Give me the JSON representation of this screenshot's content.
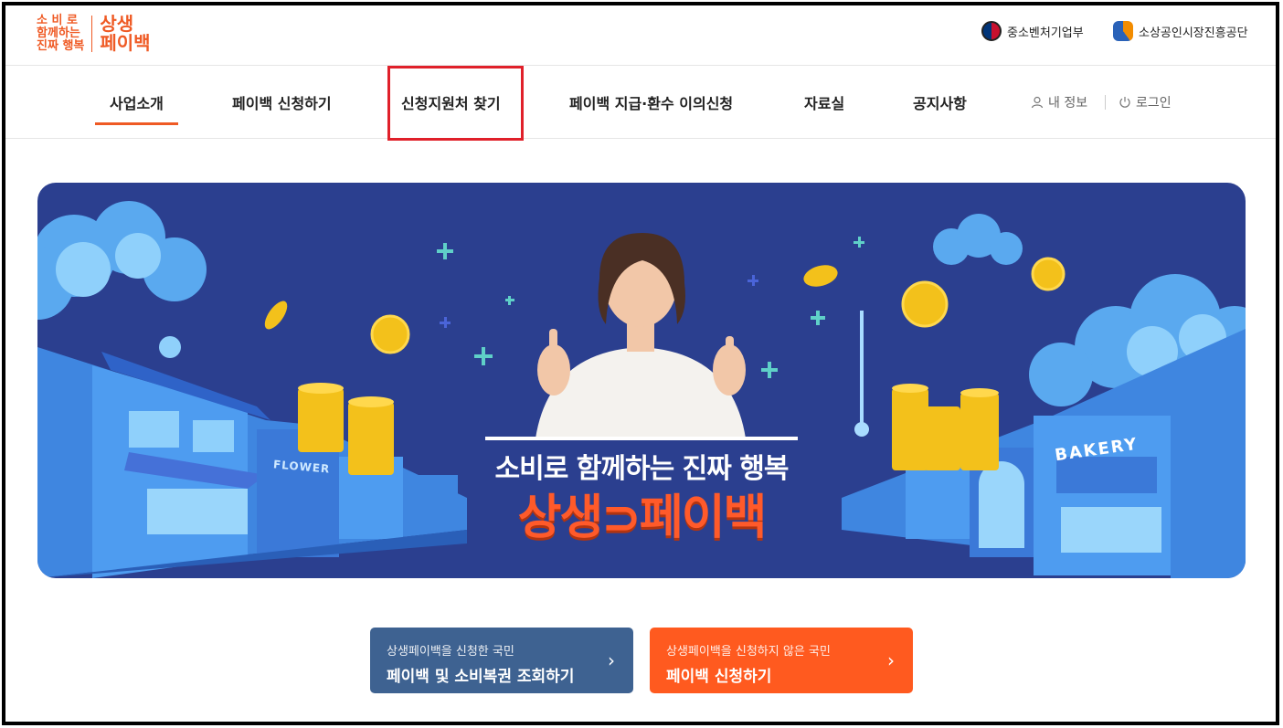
{
  "logo": {
    "tagline_lines": [
      "소 비 로",
      "함께하는",
      "진짜 행복"
    ],
    "brand_lines": [
      "상생",
      "페이백"
    ]
  },
  "header_links": {
    "ministry": "중소벤처기업부",
    "agency": "소상공인시장진흥공단"
  },
  "nav": {
    "items": [
      "사업소개",
      "페이백 신청하기",
      "신청지원처 찾기",
      "페이백 지급·환수 이의신청",
      "자료실",
      "공지사항"
    ],
    "active_index": 0,
    "my_info": "내 정보",
    "login": "로그인"
  },
  "banner": {
    "headline": "소비로 함께하는 진짜 행복",
    "brand": "상생⊃페이백",
    "sign_flower": "FLOWER",
    "sign_bakery": "BAKERY"
  },
  "cta": {
    "lookup_sub": "상생페이백을 신청한 국민",
    "lookup_main": "페이백 및 소비복권 조회하기",
    "apply_sub": "상생페이백을 신청하지 않은 국민",
    "apply_main": "페이백 신청하기",
    "chevron": "›"
  },
  "colors": {
    "brand_orange": "#ef5a24",
    "banner_bg": "#2b3f8f",
    "cta_blue": "#3e6291",
    "cta_orange": "#ff5a1f",
    "highlight": "#e0202a"
  }
}
